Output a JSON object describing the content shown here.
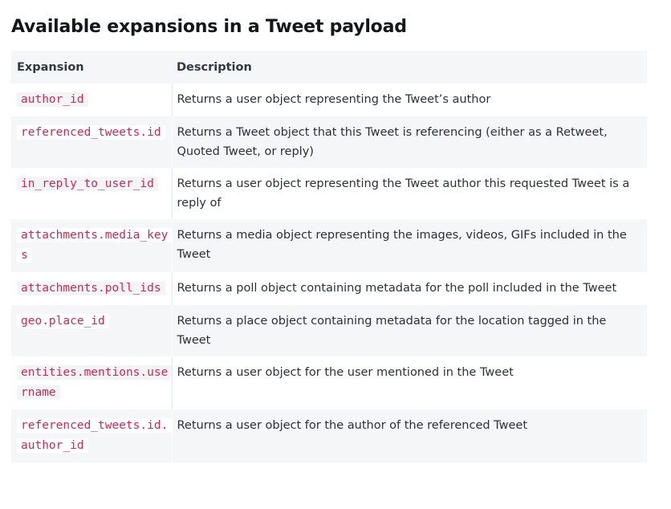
{
  "title": "Available expansions in a Tweet payload",
  "table": {
    "headers": [
      "Expansion",
      "Description"
    ],
    "rows": [
      {
        "expansion": "author_id",
        "description": "Returns a user object representing the Tweet’s author"
      },
      {
        "expansion": "referenced_tweets.id",
        "description": "Returns a Tweet object that this Tweet is referencing (either as a Retweet, Quoted Tweet, or reply)"
      },
      {
        "expansion": "in_reply_to_user_id",
        "description": "Returns a user object representing the Tweet author this requested Tweet is a reply of"
      },
      {
        "expansion": "attachments.media_keys",
        "description": "Returns a media object representing the images, videos, GIFs included in the Tweet"
      },
      {
        "expansion": "attachments.poll_ids",
        "description": "Returns a poll object containing metadata for the poll included in the Tweet"
      },
      {
        "expansion": "geo.place_id",
        "description": "Returns a place object containing metadata for the location tagged in the Tweet"
      },
      {
        "expansion": "entities.mentions.username",
        "description": "Returns a user object for the user mentioned in the Tweet"
      },
      {
        "expansion": "referenced_tweets.id.author_id",
        "description": "Returns a user object for the author of the referenced Tweet"
      }
    ]
  }
}
